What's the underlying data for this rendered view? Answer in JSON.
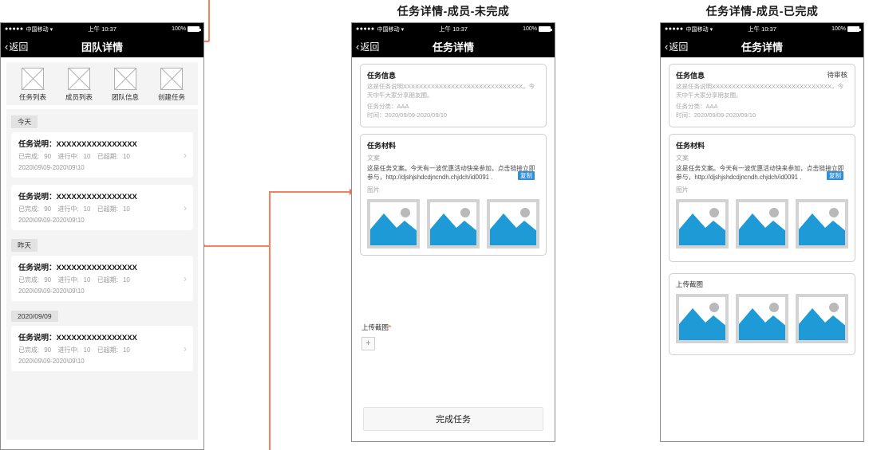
{
  "captions": {
    "middle": "任务详情-成员-未完成",
    "right": "任务详情-成员-已完成"
  },
  "colors": {
    "connector": "#f9724a",
    "image_blue": "#1E9BD7",
    "copy_badge": "#2f8fd6",
    "required_asterisk": "#e04a3b"
  },
  "status_bar": {
    "signal_dots": "●●●●●",
    "carrier": "中国移动",
    "wifi_icon": "wifi-icon",
    "time": "上午 10:37",
    "battery_text": "100%"
  },
  "phone1": {
    "nav": {
      "back_label": "返回",
      "title": "团队详情"
    },
    "tabs": [
      {
        "label": "任务列表",
        "icon": "placeholder-box-icon"
      },
      {
        "label": "成员列表",
        "icon": "placeholder-box-icon"
      },
      {
        "label": "团队信息",
        "icon": "placeholder-box-icon"
      },
      {
        "label": "创建任务",
        "icon": "placeholder-box-icon"
      }
    ],
    "groups": [
      {
        "day": "今天",
        "tasks": [
          {
            "title": "任务说明：XXXXXXXXXXXXXXXX",
            "done_label": "已完成:",
            "done_value": "90",
            "doing_label": "进行中:",
            "doing_value": "10",
            "overdue_label": "已超期:",
            "overdue_value": "10",
            "date_range": "2020\\09\\09-2020\\09\\10"
          },
          {
            "title": "任务说明：XXXXXXXXXXXXXXXX",
            "done_label": "已完成:",
            "done_value": "90",
            "doing_label": "进行中:",
            "doing_value": "10",
            "overdue_label": "已超期:",
            "overdue_value": "10",
            "date_range": "2020\\09\\09-2020\\09\\10"
          }
        ]
      },
      {
        "day": "昨天",
        "tasks": [
          {
            "title": "任务说明：XXXXXXXXXXXXXXXX",
            "done_label": "已完成:",
            "done_value": "90",
            "doing_label": "进行中:",
            "doing_value": "10",
            "overdue_label": "已超期:",
            "overdue_value": "10",
            "date_range": "2020\\09\\09-2020\\09\\10"
          }
        ]
      },
      {
        "day": "2020/09/09",
        "tasks": [
          {
            "title": "任务说明：XXXXXXXXXXXXXXXX",
            "done_label": "已完成:",
            "done_value": "90",
            "doing_label": "进行中:",
            "doing_value": "10",
            "overdue_label": "已超期:",
            "overdue_value": "10",
            "date_range": "2020\\09\\09-2020\\09\\10"
          }
        ]
      }
    ]
  },
  "phone2": {
    "nav": {
      "back_label": "返回",
      "title": "任务详情"
    },
    "task_info": {
      "heading": "任务信息",
      "description": "这是任务说明XXXXXXXXXXXXXXXXXXXXXXXXXXXXXX，今天中午大家分享朋友圈。",
      "category": "任务分类：AAA",
      "time": "时间：2020/09/09-2020/09/10"
    },
    "task_material": {
      "heading": "任务材料",
      "copy_label": "文案",
      "copy_text": "这是任务文案。今天有一波优惠活动快来参加，点击链接立即参与，http://djshjshdcdjncndh.chjdch/id0091 .",
      "copy_button": "复制",
      "image_label": "图片",
      "images": [
        "image-placeholder",
        "image-placeholder",
        "image-placeholder"
      ]
    },
    "upload": {
      "label": "上传截图",
      "required_mark": "*",
      "add_button": "+"
    },
    "submit_button": "完成任务"
  },
  "phone3": {
    "nav": {
      "back_label": "返回",
      "title": "任务详情"
    },
    "task_info": {
      "heading": "任务信息",
      "status": "待审核",
      "description": "这是任务说明XXXXXXXXXXXXXXXXXXXXXXXXXXXXXX，今天中午大家分享朋友圈。",
      "category": "任务分类：AAA",
      "time": "时间：2020/09/09-2020/09/10"
    },
    "task_material": {
      "heading": "任务材料",
      "copy_label": "文案",
      "copy_text": "这是任务文案。今天有一波优惠活动快来参加，点击链接立即参与，http://djshjshdcdjncndh.chjdch/id0091 .",
      "copy_button": "复制",
      "image_label": "图片",
      "images": [
        "image-placeholder",
        "image-placeholder",
        "image-placeholder"
      ]
    },
    "uploaded": {
      "label": "上传截图",
      "images": [
        "image-placeholder",
        "image-placeholder",
        "image-placeholder"
      ]
    }
  }
}
